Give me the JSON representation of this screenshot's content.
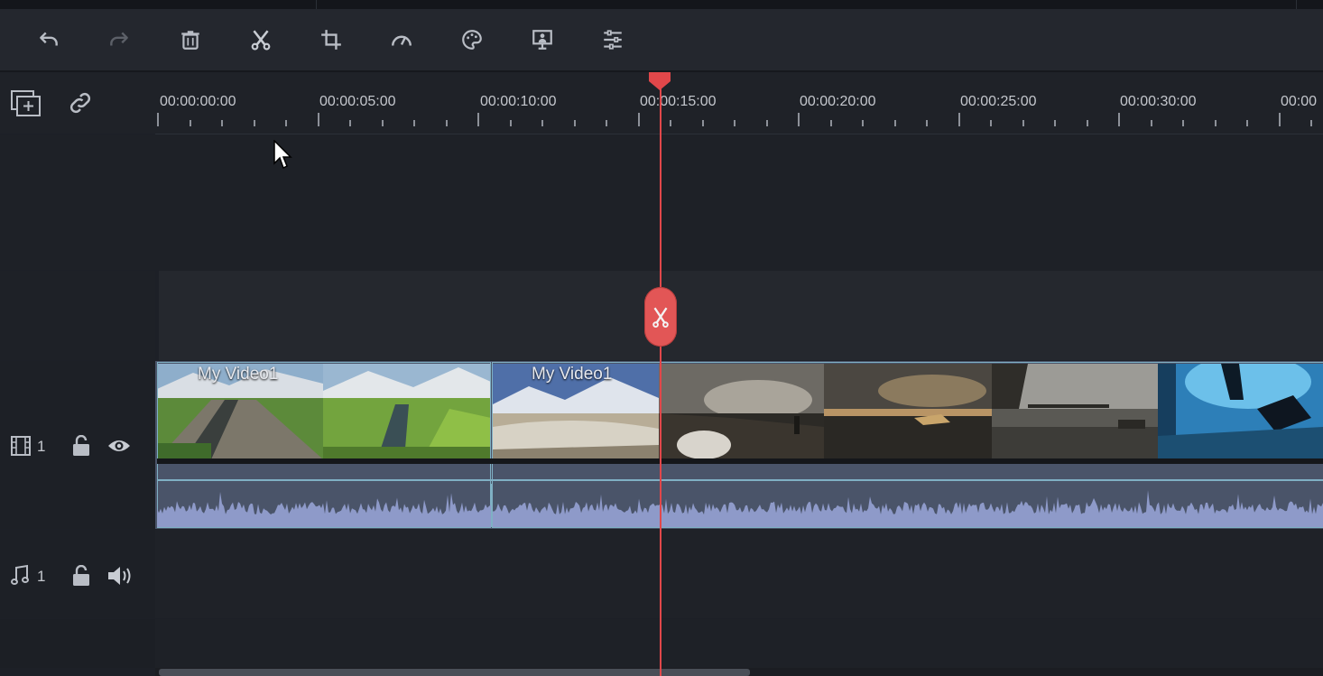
{
  "toolbar": {
    "buttons": [
      {
        "name": "undo-button",
        "icon": "undo-icon",
        "enabled": true
      },
      {
        "name": "redo-button",
        "icon": "redo-icon",
        "enabled": false
      },
      {
        "name": "delete-button",
        "icon": "trash-icon",
        "enabled": true
      },
      {
        "name": "cut-button",
        "icon": "scissors-icon",
        "enabled": true
      },
      {
        "name": "crop-button",
        "icon": "crop-icon",
        "enabled": true
      },
      {
        "name": "speed-button",
        "icon": "speedometer-icon",
        "enabled": true
      },
      {
        "name": "color-button",
        "icon": "palette-icon",
        "enabled": true
      },
      {
        "name": "green-screen-button",
        "icon": "presentation-icon",
        "enabled": true
      },
      {
        "name": "adjust-button",
        "icon": "sliders-icon",
        "enabled": true
      }
    ]
  },
  "timeline": {
    "ruler_labels": [
      "00:00:00:00",
      "00:00:05:00",
      "00:00:10:00",
      "00:00:15:00",
      "00:00:20:00",
      "00:00:25:00",
      "00:00:30:00",
      "00:00"
    ],
    "playhead_time": "00:00:14:08",
    "tracks": [
      {
        "type": "video",
        "index": "1",
        "icons": [
          "film-icon",
          "lock-open-icon",
          "eye-icon"
        ]
      },
      {
        "type": "audio",
        "index": "1",
        "icons": [
          "music-note-icon",
          "lock-open-icon",
          "speaker-icon"
        ]
      }
    ],
    "clips": [
      {
        "label": "My Video1"
      },
      {
        "label": "My Video1"
      }
    ]
  },
  "colors": {
    "playhead": "#e1474a",
    "audio_wave": "#8e9ac9",
    "clip_border": "#8fb7c9",
    "background": "#1d2027"
  }
}
